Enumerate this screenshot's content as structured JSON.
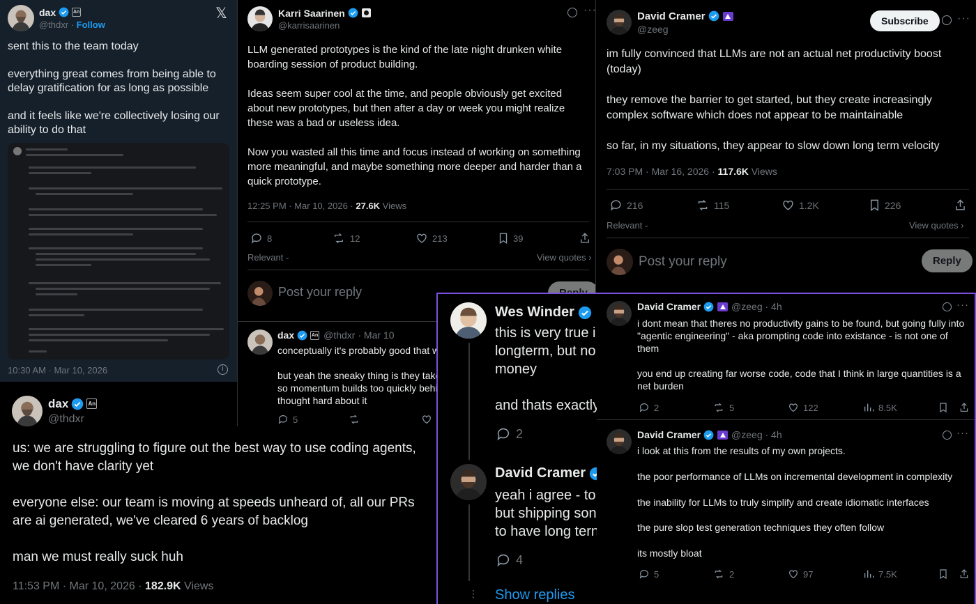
{
  "p1": {
    "name": "dax",
    "handle": "@thdxr",
    "follow": "Follow",
    "affil": "An",
    "text": "sent this to the team today\n\neverything great comes from being able to delay gratification for as long as possible\n\nand it feels like we're collectively losing our ability to do that",
    "timestamp": "10:30 AM · Mar 10, 2026",
    "x_icon": "x-logo-icon",
    "info_icon": "info-icon"
  },
  "p2": {
    "name": "Karri Saarinen",
    "handle": "@karrisaarinen",
    "text": "LLM generated prototypes is the kind of the late night drunken white boarding session of product building.\n\nIdeas seem super cool at the time, and people obviously get excited about new prototypes, but then after a day or week you might realize these was a bad or useless idea.\n\nNow you wasted all this time and focus instead of working on something more meaningful, and maybe something more deeper and harder than a quick prototype.",
    "time": "12:25 PM · Mar 10, 2026 · ",
    "views_count": "27.6K",
    "views_label": " Views",
    "replies": "8",
    "reposts": "12",
    "likes": "213",
    "bookmarks": "39",
    "relevant": "Relevant",
    "view_quotes": "View quotes",
    "reply_placeholder": "Post your reply",
    "reply_btn": "Reply",
    "sub": {
      "name": "dax",
      "meta": "@thdxr · Mar 10",
      "text1": "conceptually it's probably good that w",
      "text2": "but yeah the sneaky thing is they take\nso momentum builds too quickly behi\nthought hard about it",
      "replies": "5"
    }
  },
  "p3": {
    "name": "David Cramer",
    "handle": "@zeeg",
    "subscribe": "Subscribe",
    "text": "im fully convinced that LLMs are not an actual net productivity boost (today)\n\nthey remove the barrier to get started, but they create increasingly complex software which does not appear to be maintainable\n\nso far, in my situations, they appear to slow down long term velocity",
    "time": "7:03 PM · Mar 16, 2026 · ",
    "views_count": "117.6K",
    "views_label": " Views",
    "replies": "216",
    "reposts": "115",
    "likes": "1.2K",
    "bookmarks": "226",
    "relevant": "Relevant",
    "view_quotes": "View quotes",
    "reply_placeholder": "Post your reply",
    "reply_btn": "Reply"
  },
  "p4": {
    "name": "dax",
    "handle": "@thdxr",
    "affil": "An",
    "text": "us: we are struggling to figure out the best way to use coding agents, we don't have clarity yet\n\neveryone else: our team is moving at speeds unheard of, all our PRs are ai generated, we've cleared 6 years of backlog\n\nman we must really suck huh",
    "time": "11:53 PM · Mar 10, 2026 · ",
    "views_count": "182.9K",
    "views_label": " Views"
  },
  "p5": {
    "wes_name": "Wes Winder",
    "wes_text": "this is very true i\nlongterm, but no\nmoney\n\nand thats exactly",
    "wes_replies": "2",
    "david_name": "David Cramer",
    "david_text": "yeah i agree - to\nbut shipping son\nto have long tern",
    "david_replies": "4",
    "show_replies": "Show replies"
  },
  "p6": {
    "a": {
      "name": "David Cramer",
      "meta": "@zeeg · 4h",
      "text": "i dont mean that theres no productivity gains to be found, but going fully into \"agentic engineering\" - aka prompting code into existance - is not one of them\n\nyou end up creating far worse code, code that I think in large quantities is a net burden",
      "replies": "2",
      "reposts": "5",
      "likes": "122",
      "views": "8.5K"
    },
    "b": {
      "name": "David Cramer",
      "meta": "@zeeg · 4h",
      "text": "i look at this from the results of my own projects.\n\nthe poor performance of LLMs on incremental development in complexity\n\nthe inability for LLMs to truly simplify and create idiomatic interfaces\n\nthe pure slop test generation techniques they often follow\n\nits mostly bloat",
      "replies": "5",
      "reposts": "2",
      "likes": "97",
      "views": "7.5K"
    }
  },
  "colors": {
    "accent": "#1d9bf0",
    "frame": "#7b4fe0",
    "muted": "#71767b",
    "bg": "#000000"
  }
}
